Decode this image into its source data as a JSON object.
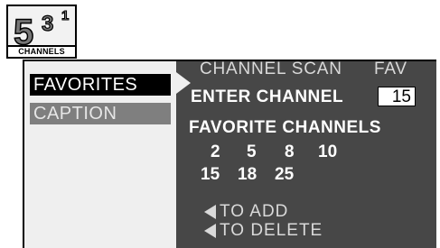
{
  "logo": {
    "digit_main": "5",
    "digit_mid": "3",
    "digit_small": "1",
    "label": "CHANNELS"
  },
  "menu": {
    "items": [
      {
        "label": "FAVORITES",
        "selected": true
      },
      {
        "label": "CAPTION",
        "selected": false
      }
    ]
  },
  "panel": {
    "header_left": "CHANNEL SCAN",
    "header_right": "FAV",
    "enter_channel_label": "ENTER CHANNEL",
    "enter_channel_value": "15",
    "favorites_title": "FAVORITE CHANNELS",
    "favorites": [
      "2",
      "5",
      "8",
      "10",
      "15",
      "18",
      "25"
    ],
    "hint_add": "TO ADD",
    "hint_delete": "TO DELETE"
  },
  "colors": {
    "panel_bg": "#474747",
    "sidebar_bg": "#efefef",
    "selected_bg": "#000000",
    "unselected_bg": "#7f7f7f"
  }
}
